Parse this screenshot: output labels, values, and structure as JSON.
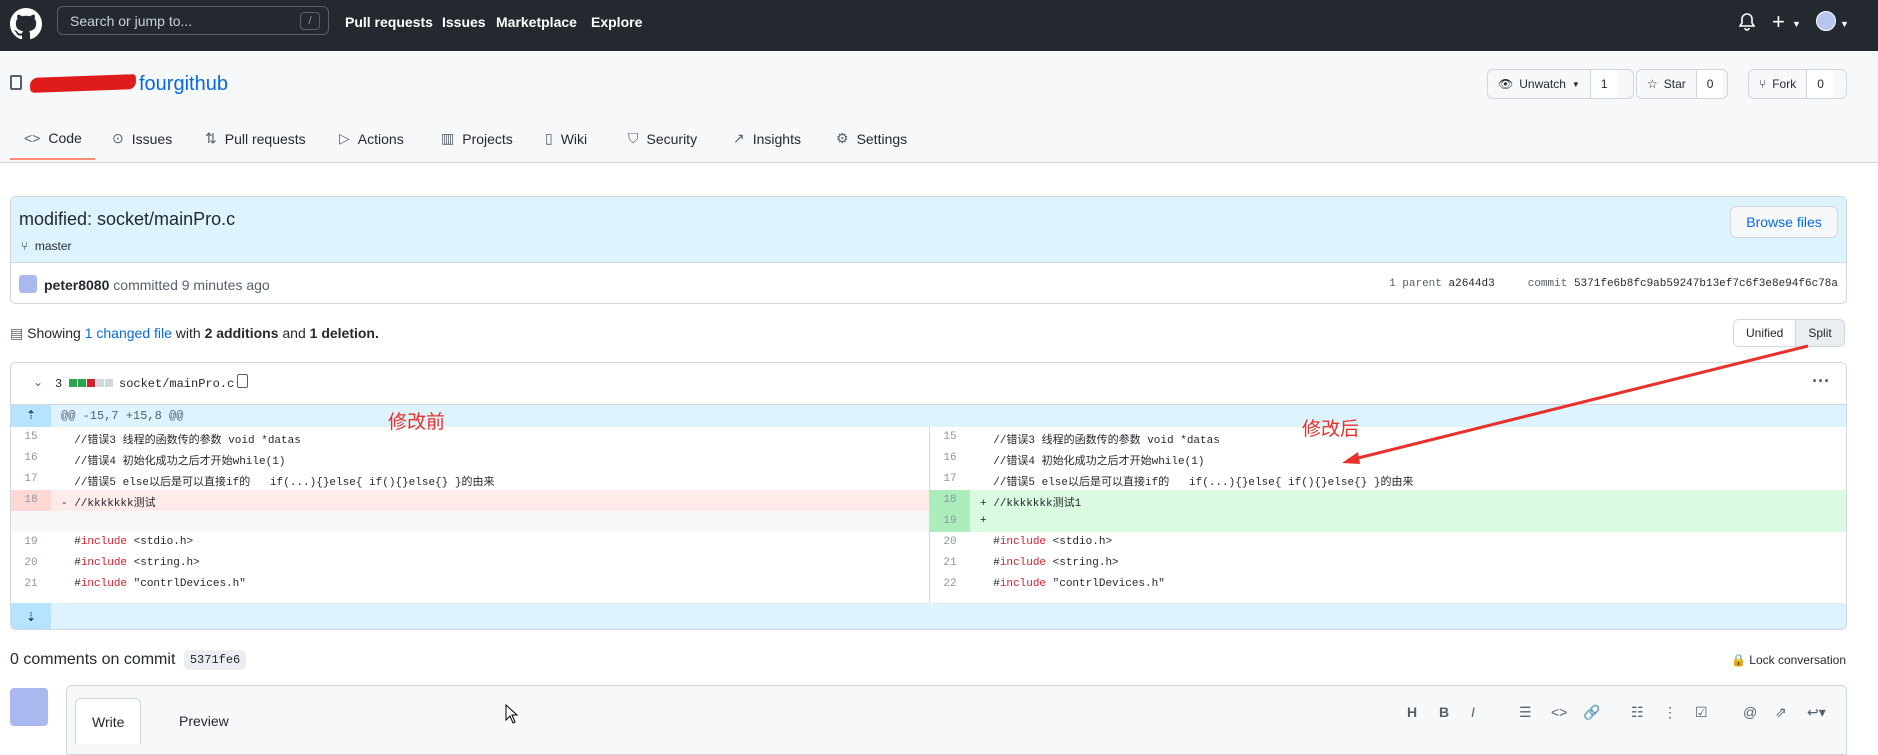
{
  "header": {
    "search_placeholder": "Search or jump to...",
    "search_shortcut": "/",
    "nav": [
      "Pull requests",
      "Issues",
      "Marketplace",
      "Explore"
    ],
    "icons": [
      "github-logo-icon",
      "bell-icon",
      "plus-icon",
      "avatar"
    ]
  },
  "repo": {
    "name": "fourgithub",
    "owner_redacted": true,
    "unwatch_label": "Unwatch",
    "unwatch_count": "1",
    "star_label": "Star",
    "star_count": "0",
    "fork_label": "Fork",
    "fork_count": "0"
  },
  "tabs": [
    {
      "label": "Code",
      "icon": "code-icon"
    },
    {
      "label": "Issues",
      "icon": "issue-icon"
    },
    {
      "label": "Pull requests",
      "icon": "pull-request-icon"
    },
    {
      "label": "Actions",
      "icon": "play-icon"
    },
    {
      "label": "Projects",
      "icon": "project-icon"
    },
    {
      "label": "Wiki",
      "icon": "book-icon"
    },
    {
      "label": "Security",
      "icon": "shield-icon"
    },
    {
      "label": "Insights",
      "icon": "graph-icon"
    },
    {
      "label": "Settings",
      "icon": "gear-icon"
    }
  ],
  "commit": {
    "title": "modified: socket/mainPro.c",
    "branch": "master",
    "browse_label": "Browse files",
    "author": "peter8080",
    "action_text": "committed 9 minutes ago",
    "parent_label": "1 parent",
    "parent_sha": "a2644d3",
    "commit_label": "commit",
    "commit_sha": "5371fe6b8fc9ab59247b13ef7c6f3e8e94f6c78a"
  },
  "summary": {
    "prefix": "Showing",
    "changed": "1 changed file",
    "mid": "with",
    "additions": "2 additions",
    "and": "and",
    "deletions": "1 deletion.",
    "unified_label": "Unified",
    "split_label": "Split"
  },
  "diff": {
    "file_changes": "3",
    "filename": "socket/mainPro.c",
    "hunk_header": "@@ -15,7 +15,8 @@",
    "left": [
      {
        "num": "15",
        "code": "  //错误3 线程的函数传的参数 void *datas"
      },
      {
        "num": "16",
        "code": "  //错误4 初始化成功之后才开始while(1)"
      },
      {
        "num": "17",
        "code": "  //错误5 else以后是可以直接if的   if(...){}else{ if(){}else{} }的由来"
      },
      {
        "num": "18",
        "code": "- //kkkkkkk测试"
      },
      {
        "num": "",
        "code": ""
      },
      {
        "num": "19",
        "code": "  #include <stdio.h>"
      },
      {
        "num": "20",
        "code": "  #include <string.h>"
      },
      {
        "num": "21",
        "code": "  #include \"contrlDevices.h\""
      }
    ],
    "right": [
      {
        "num": "15",
        "code": "  //错误3 线程的函数传的参数 void *datas"
      },
      {
        "num": "16",
        "code": "  //错误4 初始化成功之后才开始while(1)"
      },
      {
        "num": "17",
        "code": "  //错误5 else以后是可以直接if的   if(...){}else{ if(){}else{} }的由来"
      },
      {
        "num": "18",
        "code": "+ //kkkkkkk测试1"
      },
      {
        "num": "19",
        "code": "+ "
      },
      {
        "num": "20",
        "code": "  #include <stdio.h>"
      },
      {
        "num": "21",
        "code": "  #include <string.h>"
      },
      {
        "num": "22",
        "code": "  #include \"contrlDevices.h\""
      }
    ],
    "annotation_before": "修改前",
    "annotation_after": "修改后"
  },
  "comments": {
    "title": "0 comments on commit",
    "sha": "5371fe6",
    "lock_label": "Lock conversation",
    "write_tab": "Write",
    "preview_tab": "Preview",
    "toolbar": [
      "H",
      "B",
      "I",
      "quote-icon",
      "code-icon",
      "link-icon",
      "bullet-list-icon",
      "numbered-list-icon",
      "task-list-icon",
      "mention-icon",
      "reference-icon",
      "reply-icon"
    ]
  },
  "colors": {
    "header_bg": "#24292f",
    "link": "#0969da",
    "deletion_bg": "#ffebe9",
    "addition_bg": "#dafbe1",
    "annotation": "#e8312b"
  }
}
